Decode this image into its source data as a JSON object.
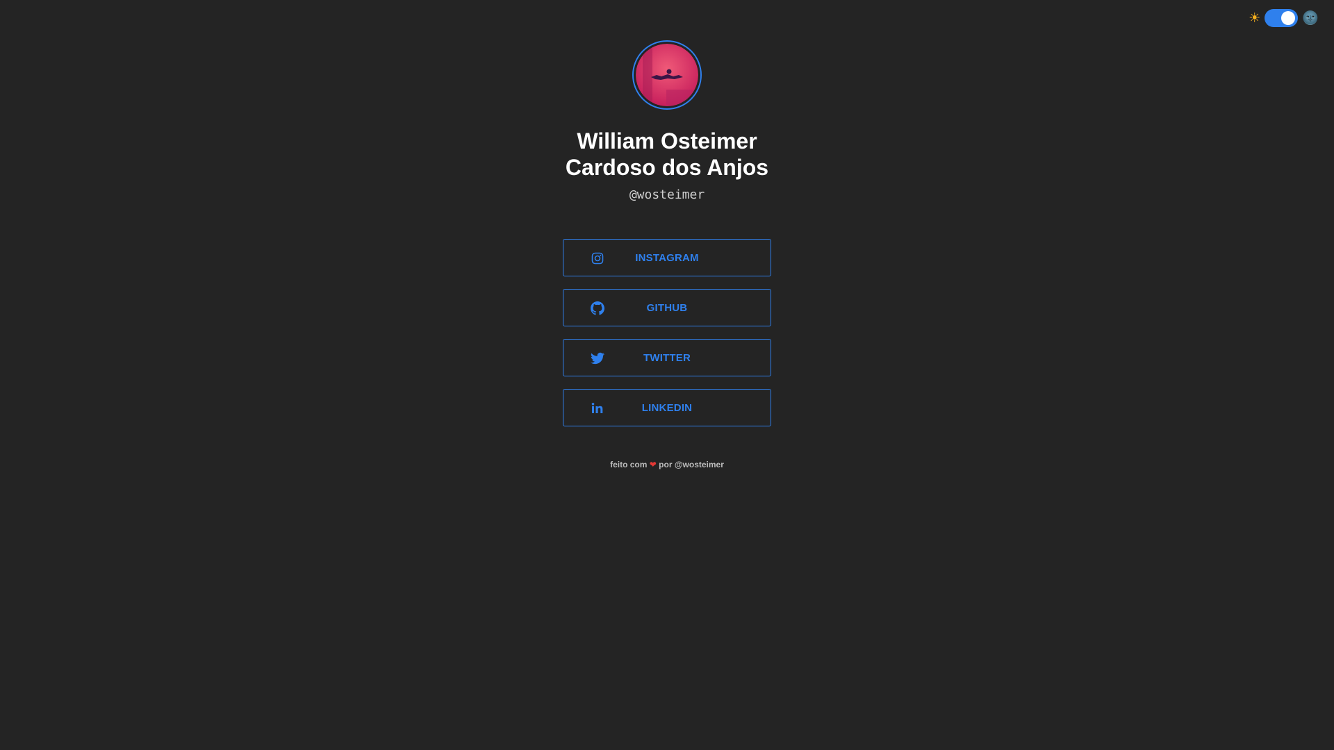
{
  "theme_switch": {
    "light_icon": "☀",
    "dark_icon": "🌚",
    "state": "dark"
  },
  "profile": {
    "name_line1": "William Osteimer",
    "name_line2": "Cardoso dos Anjos",
    "handle": "@wosteimer"
  },
  "links": [
    {
      "label": "INSTAGRAM",
      "icon": "instagram-icon"
    },
    {
      "label": "GITHUB",
      "icon": "github-icon"
    },
    {
      "label": "TWITTER",
      "icon": "twitter-icon"
    },
    {
      "label": "LINKEDIN",
      "icon": "linkedin-icon"
    }
  ],
  "footer": {
    "prefix": "feito com",
    "heart": "❤",
    "suffix": "por @wosteimer"
  },
  "colors": {
    "background": "#242424",
    "accent": "#2f80ed"
  }
}
